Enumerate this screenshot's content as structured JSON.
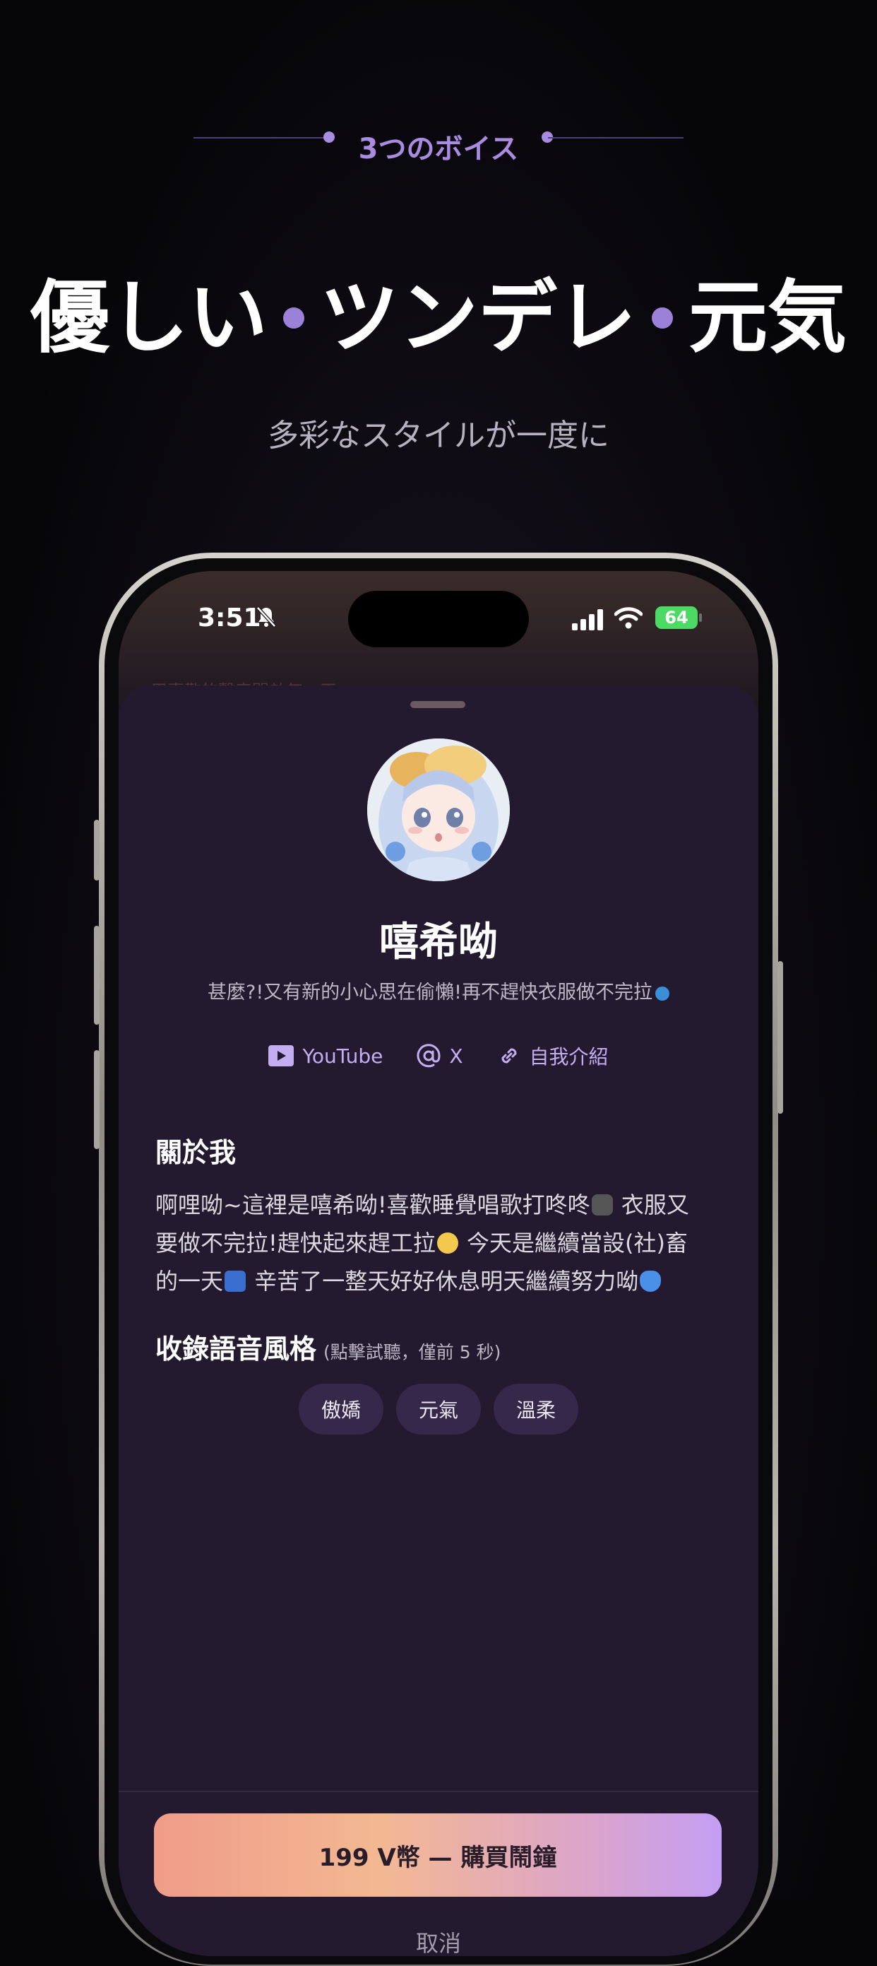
{
  "promo": {
    "badge": "3つのボイス",
    "headline": {
      "word1": "優しい",
      "word2": "ツンデレ",
      "word3": "元気"
    },
    "subhead": "多彩なスタイルが一度に"
  },
  "statusbar": {
    "time": "3:51",
    "battery": "64"
  },
  "background_text": "用喜歡的聲音開啟每一天",
  "profile": {
    "name": "嘻希呦",
    "tagline": "甚麼?!又有新的小心思在偷懶!再不趕快衣服做不完拉",
    "links": [
      {
        "label": "YouTube",
        "icon": "youtube-icon"
      },
      {
        "label": "X",
        "icon": "at-icon"
      },
      {
        "label": "自我介紹",
        "icon": "link-icon"
      }
    ],
    "about_title": "關於我",
    "about_text": [
      "啊哩呦~這裡是嘻希呦!喜歡睡覺唱歌打咚咚",
      " 衣服又",
      "要做不完拉!趕快起來趕工拉",
      " 今天是繼續當設(社)畜",
      "的一天",
      " 辛苦了一整天好好休息明天繼續努力呦"
    ],
    "voice_title": "收錄語音風格",
    "voice_note": "(點擊試聽，僅前 5 秒)",
    "voice_styles": [
      "傲嬌",
      "元氣",
      "溫柔"
    ]
  },
  "actions": {
    "buy_label": "199 V幣 — 購買鬧鐘",
    "cancel_label": "取消"
  },
  "colors": {
    "accent": "#a98be0",
    "sheet": "#231a2f",
    "chip": "#35284a"
  }
}
